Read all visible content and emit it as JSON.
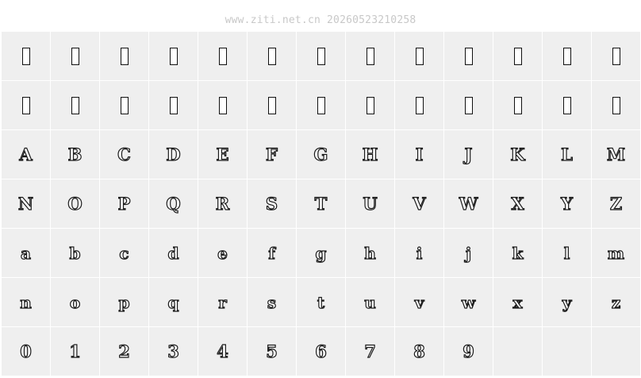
{
  "watermark": "www.ziti.net.cn 20260523210258",
  "rows": [
    {
      "kind": "tofu",
      "glyphs": [
        "",
        "",
        "",
        "",
        "",
        "",
        "",
        "",
        "",
        "",
        "",
        "",
        ""
      ]
    },
    {
      "kind": "tofu",
      "glyphs": [
        "",
        "",
        "",
        "",
        "",
        "",
        "",
        "",
        "",
        "",
        "",
        "",
        ""
      ]
    },
    {
      "kind": "upper",
      "glyphs": [
        "A",
        "B",
        "C",
        "D",
        "E",
        "F",
        "G",
        "H",
        "I",
        "J",
        "K",
        "L",
        "M"
      ]
    },
    {
      "kind": "upper",
      "glyphs": [
        "N",
        "O",
        "P",
        "Q",
        "R",
        "S",
        "T",
        "U",
        "V",
        "W",
        "X",
        "Y",
        "Z"
      ]
    },
    {
      "kind": "lower",
      "glyphs": [
        "a",
        "b",
        "c",
        "d",
        "e",
        "f",
        "g",
        "h",
        "i",
        "j",
        "k",
        "l",
        "m"
      ]
    },
    {
      "kind": "lower",
      "glyphs": [
        "n",
        "o",
        "p",
        "q",
        "r",
        "s",
        "t",
        "u",
        "v",
        "w",
        "x",
        "y",
        "z"
      ]
    },
    {
      "kind": "digit",
      "glyphs": [
        "0",
        "1",
        "2",
        "3",
        "4",
        "5",
        "6",
        "7",
        "8",
        "9",
        "",
        "",
        ""
      ]
    }
  ]
}
